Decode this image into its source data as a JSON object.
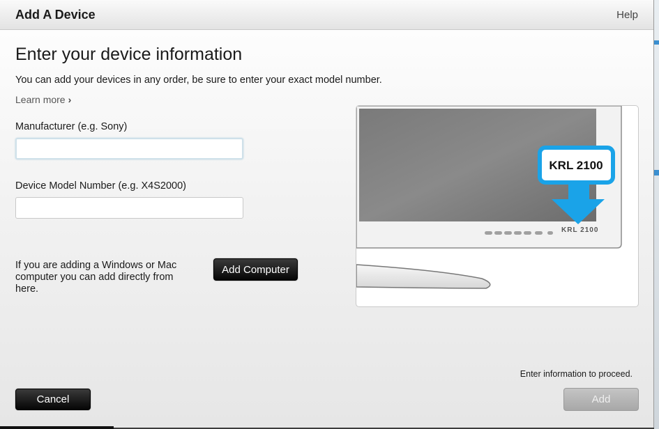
{
  "window": {
    "title": "Add A Device",
    "help_label": "Help"
  },
  "main": {
    "heading": "Enter your device information",
    "subtext": "You can add your devices in any order, be sure to enter your exact model number.",
    "learn_more": "Learn more",
    "manufacturer_label": "Manufacturer   (e.g. Sony)",
    "manufacturer_value": "",
    "model_label": "Device Model Number  (e.g. X4S2000)",
    "model_value": "",
    "computer_note": "If you are adding a Windows or Mac computer you can add directly from here.",
    "add_computer_label": "Add Computer"
  },
  "illustration": {
    "callout_text": "KRL 2100",
    "model_plate_text": "KRL 2100",
    "accent_color": "#1aa3e8"
  },
  "footer": {
    "status_text": "Enter information to proceed.",
    "cancel_label": "Cancel",
    "add_label": "Add"
  }
}
